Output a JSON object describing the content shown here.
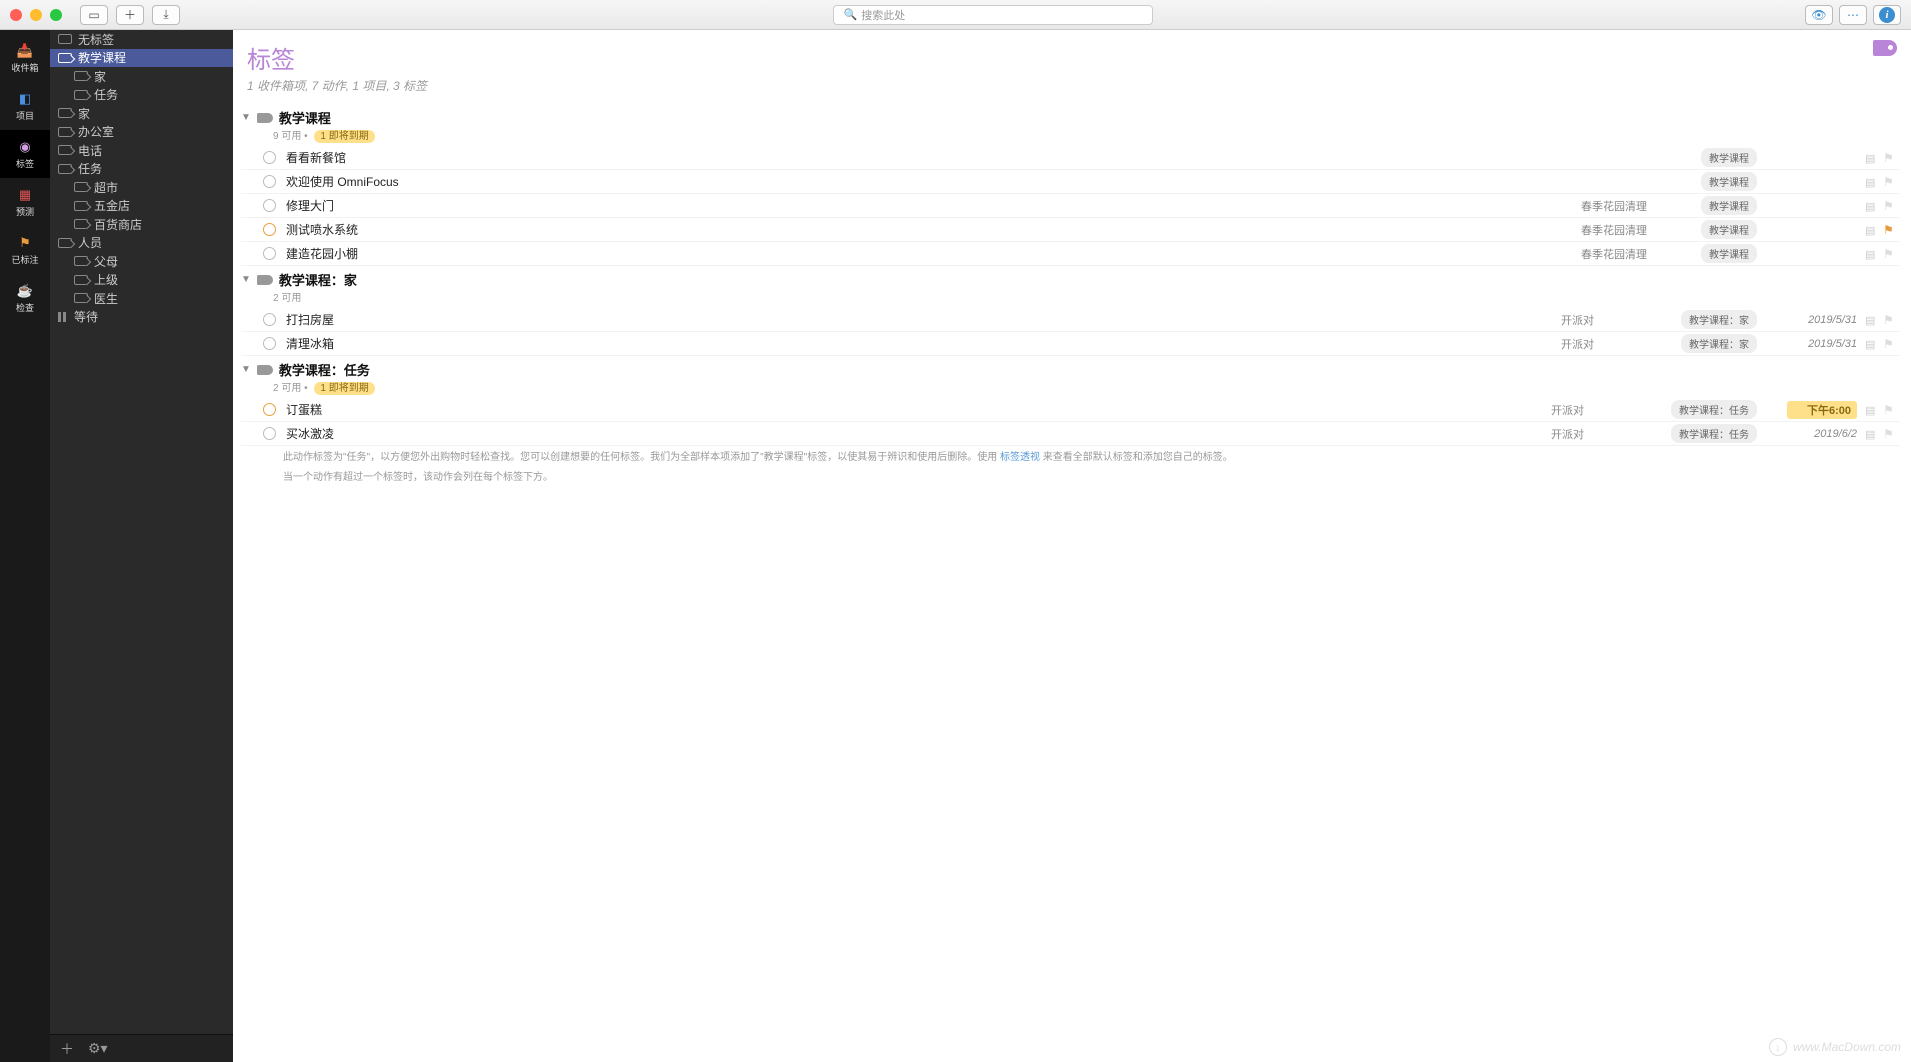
{
  "toolbar": {
    "search_placeholder": "搜索此处"
  },
  "nav": [
    {
      "label": "收件箱",
      "cls": "ni-inbox",
      "icon": "📥"
    },
    {
      "label": "项目",
      "cls": "ni-proj",
      "icon": "◧"
    },
    {
      "label": "标签",
      "cls": "ni-tags",
      "icon": "◉",
      "active": true
    },
    {
      "label": "预测",
      "cls": "ni-fore",
      "icon": "▦"
    },
    {
      "label": "已标注",
      "cls": "ni-flag",
      "icon": "⚑"
    },
    {
      "label": "检查",
      "cls": "ni-rev",
      "icon": "☕"
    }
  ],
  "sidebar": [
    {
      "label": "无标签",
      "type": "notag"
    },
    {
      "label": "教学课程",
      "type": "tag",
      "sel": true
    },
    {
      "label": "家",
      "type": "tag",
      "child": true
    },
    {
      "label": "任务",
      "type": "tag",
      "child": true
    },
    {
      "label": "家",
      "type": "tag"
    },
    {
      "label": "办公室",
      "type": "tag"
    },
    {
      "label": "电话",
      "type": "tag"
    },
    {
      "label": "任务",
      "type": "tag"
    },
    {
      "label": "超市",
      "type": "tag",
      "child": true
    },
    {
      "label": "五金店",
      "type": "tag",
      "child": true
    },
    {
      "label": "百货商店",
      "type": "tag",
      "child": true
    },
    {
      "label": "人员",
      "type": "tag"
    },
    {
      "label": "父母",
      "type": "tag",
      "child": true
    },
    {
      "label": "上级",
      "type": "tag",
      "child": true
    },
    {
      "label": "医生",
      "type": "tag",
      "child": true
    },
    {
      "label": "等待",
      "type": "pause"
    }
  ],
  "header": {
    "title": "标签",
    "subtitle": "1 收件箱项, 7 动作, 1 项目, 3 标签"
  },
  "groups": [
    {
      "title": "教学课程",
      "available": "9 可用",
      "due": "1 即将到期",
      "tasks": [
        {
          "title": "看看新餐馆",
          "tag": "教学课程"
        },
        {
          "title": "欢迎使用 OmniFocus",
          "tag": "教学课程"
        },
        {
          "title": "修理大门",
          "proj": "春季花园清理",
          "tag": "教学课程"
        },
        {
          "title": "测试喷水系统",
          "proj": "春季花园清理",
          "tag": "教学课程",
          "soon": true,
          "flag": true
        },
        {
          "title": "建造花园小棚",
          "proj": "春季花园清理",
          "tag": "教学课程"
        }
      ]
    },
    {
      "title": "教学课程：家",
      "available": "2 可用",
      "tasks": [
        {
          "title": "打扫房屋",
          "proj": "开派对",
          "tag": "教学课程：家",
          "date": "2019/5/31"
        },
        {
          "title": "清理冰箱",
          "proj": "开派对",
          "tag": "教学课程：家",
          "date": "2019/5/31"
        }
      ]
    },
    {
      "title": "教学课程：任务",
      "available": "2 可用",
      "due": "1 即将到期",
      "tasks": [
        {
          "title": "订蛋糕",
          "proj": "开派对",
          "tag": "教学课程：任务",
          "date": "下午6:00",
          "soon": true,
          "due_date": true
        },
        {
          "title": "买冰激凌",
          "proj": "开派对",
          "tag": "教学课程：任务",
          "date": "2019/6/2",
          "note_pre": "此动作标签为\"任务\"，以方便您外出购物时轻松查找。您可以创建想要的任何标签。我们为全部样本项添加了\"教学课程\"标签，以使其易于辨识和使用后删除。使用 ",
          "note_link": "标签透视",
          "note_post": " 来查看全部默认标签和添加您自己的标签。",
          "note2": "当一个动作有超过一个标签时，该动作会列在每个标签下方。"
        }
      ]
    }
  ],
  "watermark": "www.MacDown.com"
}
